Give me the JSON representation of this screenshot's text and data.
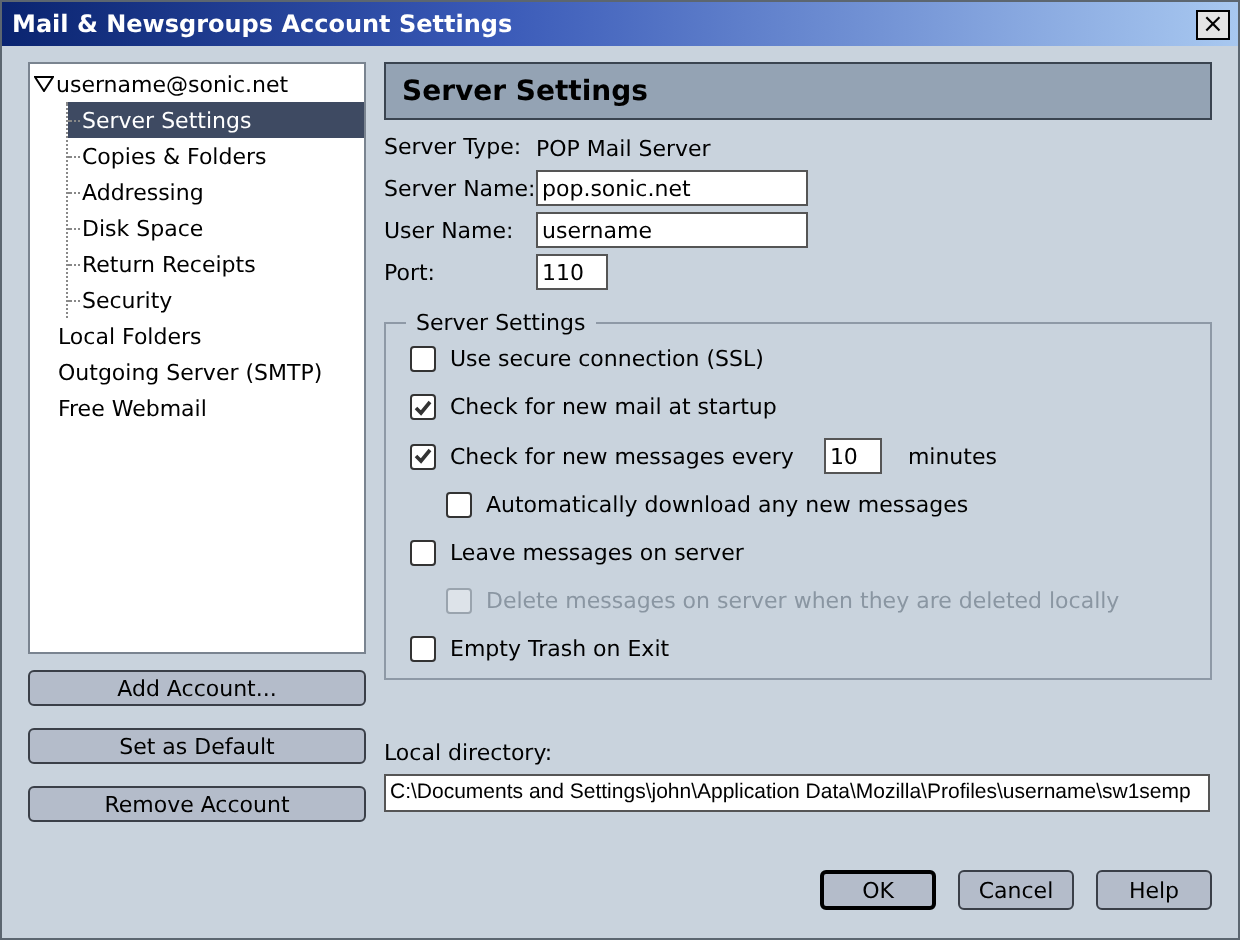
{
  "window": {
    "title": "Mail & Newsgroups Account Settings",
    "close": "×"
  },
  "accounts_tree": [
    {
      "label": "username@sonic.net",
      "selected": false,
      "expanded": true,
      "children": [
        {
          "label": "Server Settings",
          "selected": true
        },
        {
          "label": "Copies & Folders",
          "selected": false
        },
        {
          "label": "Addressing",
          "selected": false
        },
        {
          "label": "Disk Space",
          "selected": false
        },
        {
          "label": "Return Receipts",
          "selected": false
        },
        {
          "label": "Security",
          "selected": false
        }
      ]
    },
    {
      "label": "Local Folders",
      "selected": false
    },
    {
      "label": "Outgoing Server (SMTP)",
      "selected": false
    },
    {
      "label": "Free Webmail",
      "selected": false
    }
  ],
  "account_buttons": [
    "Add Account...",
    "Set as Default",
    "Remove Account"
  ],
  "panel": {
    "title": "Server Settings",
    "fields": [
      {
        "kind": "text",
        "label": "Server Type:",
        "value": "POP Mail Server"
      },
      {
        "kind": "input",
        "label": "Server Name:",
        "value": "pop.sonic.net"
      },
      {
        "kind": "input",
        "label": "User Name:",
        "value": "username"
      },
      {
        "kind": "short_input",
        "label": "Port:",
        "value": "110"
      }
    ],
    "group": {
      "title": "Server Settings",
      "options": [
        {
          "kind": "checkbox",
          "label": "Use secure connection (SSL)",
          "checked": false,
          "disabled": false
        },
        {
          "kind": "checkbox",
          "label": "Check for new mail at startup",
          "checked": true,
          "disabled": false
        },
        {
          "kind": "checkbox_with_field",
          "label": "Check for new messages every",
          "field_value": "10",
          "suffix": "minutes",
          "checked": true,
          "disabled": false,
          "children": [
            {
              "kind": "checkbox",
              "label": "Automatically download any new messages",
              "checked": false,
              "disabled": false
            }
          ]
        },
        {
          "kind": "checkbox",
          "label": "Leave messages on server",
          "checked": false,
          "disabled": false,
          "children": [
            {
              "kind": "checkbox",
              "label": "Delete messages on server when they are deleted locally",
              "checked": false,
              "disabled": true
            }
          ]
        },
        {
          "kind": "checkbox",
          "label": "Empty Trash on Exit",
          "checked": false,
          "disabled": false
        }
      ]
    },
    "local_directory": {
      "label": "Local directory:",
      "value": "C:\\Documents and Settings\\john\\Application Data\\Mozilla\\Profiles\\username\\sw1semp"
    }
  },
  "dialog_buttons": [
    {
      "label": "OK",
      "default": true
    },
    {
      "label": "Cancel",
      "default": false
    },
    {
      "label": "Help",
      "default": false
    }
  ]
}
